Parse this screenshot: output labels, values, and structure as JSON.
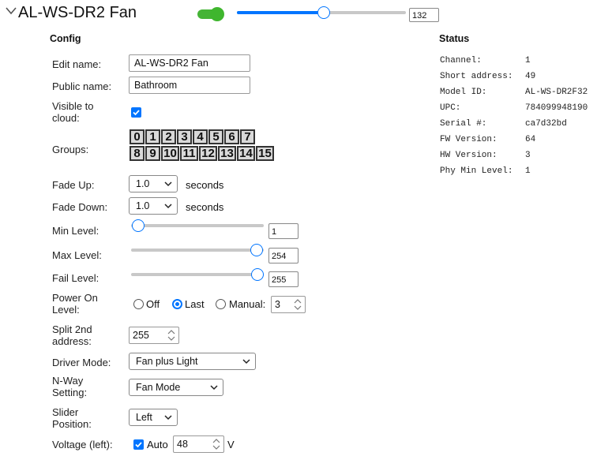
{
  "header": {
    "title": "AL-WS-DR2 Fan",
    "enabled": true,
    "level": 132,
    "level_max": 255,
    "level_input": "132"
  },
  "config": {
    "heading": "Config",
    "edit_name": {
      "label": "Edit name:",
      "value": "AL-WS-DR2 Fan"
    },
    "public_name": {
      "label": "Public name:",
      "value": "Bathroom"
    },
    "visible": {
      "label_1": "Visible to",
      "label_2": "cloud:",
      "checked": true
    },
    "groups": {
      "label": "Groups:",
      "row1": [
        "0",
        "1",
        "2",
        "3",
        "4",
        "5",
        "6",
        "7"
      ],
      "row2": [
        "8",
        "9",
        "10",
        "11",
        "12",
        "13",
        "14",
        "15"
      ]
    },
    "fade_up": {
      "label": "Fade Up:",
      "value": "1.0",
      "unit": "seconds"
    },
    "fade_down": {
      "label": "Fade Down:",
      "value": "1.0",
      "unit": "seconds"
    },
    "min_level": {
      "label": "Min Level:",
      "value": 1,
      "input": "1"
    },
    "max_level": {
      "label": "Max Level:",
      "value": 254,
      "input": "254"
    },
    "fail_level": {
      "label": "Fail Level:",
      "value": 255,
      "input": "255"
    },
    "power_on": {
      "label_1": "Power On",
      "label_2": "Level:",
      "options": [
        "Off",
        "Last",
        "Manual:"
      ],
      "selected": "Last",
      "manual_value": "3"
    },
    "split": {
      "label_1": "Split 2nd",
      "label_2": "address:",
      "value": "255"
    },
    "driver_mode": {
      "label": "Driver Mode:",
      "value": "Fan plus Light"
    },
    "nway": {
      "label_1": "N-Way",
      "label_2": "Setting:",
      "value": "Fan Mode"
    },
    "slider_pos": {
      "label_1": "Slider",
      "label_2": "Position:",
      "value": "Left"
    },
    "voltage": {
      "label": "Voltage (left):",
      "auto_label": "Auto",
      "auto_checked": true,
      "value": "48",
      "unit": "V"
    }
  },
  "status": {
    "heading": "Status",
    "rows": [
      {
        "key": "Channel:",
        "value": "1"
      },
      {
        "key": "Short address:",
        "value": "49"
      },
      {
        "key": "Model ID:",
        "value": "AL-WS-DR2F32"
      },
      {
        "key": "UPC:",
        "value": "784099948190"
      },
      {
        "key": "Serial #:",
        "value": "ca7d32bd"
      },
      {
        "key": "FW Version:",
        "value": "64"
      },
      {
        "key": "HW Version:",
        "value": "3"
      },
      {
        "key": "Phy Min Level:",
        "value": "1"
      }
    ]
  },
  "colors": {
    "accent": "#0075ff",
    "toggle_on": "#3fb62e"
  }
}
